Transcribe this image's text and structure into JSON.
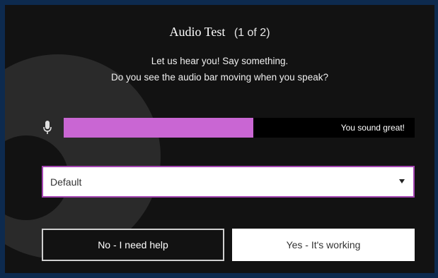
{
  "dialog": {
    "title": "Audio Test",
    "step_counter": "(1 of 2)",
    "instruction_line1": "Let us hear you! Say something.",
    "instruction_line2": "Do you see the audio bar moving when you speak?"
  },
  "audio_meter": {
    "icon": "microphone-icon",
    "level_percent": 54,
    "status_text": "You sound great!",
    "fill_color": "#c966d3"
  },
  "device_select": {
    "selected_value": "Default",
    "icon": "caret-down-icon",
    "border_color": "#a445b2"
  },
  "actions": {
    "no_label": "No - I need help",
    "yes_label": "Yes - It's working"
  },
  "colors": {
    "page_background": "#0d2a4e",
    "dialog_background": "#121212"
  }
}
